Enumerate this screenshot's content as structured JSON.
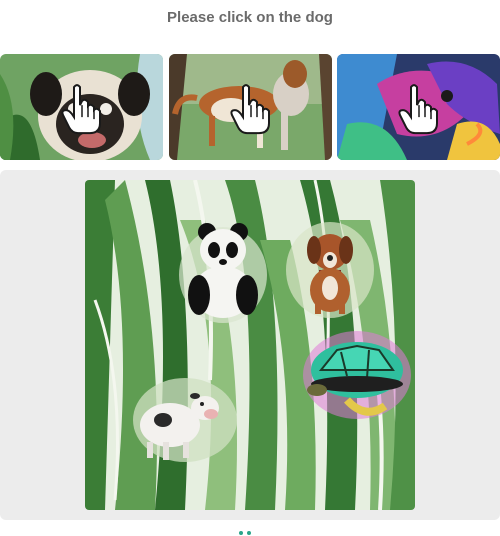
{
  "prompt": "Please click on the dog",
  "thumbnails": [
    {
      "subject": "pug dog",
      "icon": "pointer-hand-icon"
    },
    {
      "subject": "brown and white dog",
      "icon": "pointer-hand-icon"
    },
    {
      "subject": "colorful dog",
      "icon": "pointer-hand-icon"
    }
  ],
  "scene": {
    "animals": [
      "panda",
      "dog",
      "turtle",
      "cow"
    ]
  },
  "colors": {
    "prompt_text": "#6b6b6b",
    "panel_bg": "#ececec",
    "leaf_green": "#3f8a3a"
  }
}
